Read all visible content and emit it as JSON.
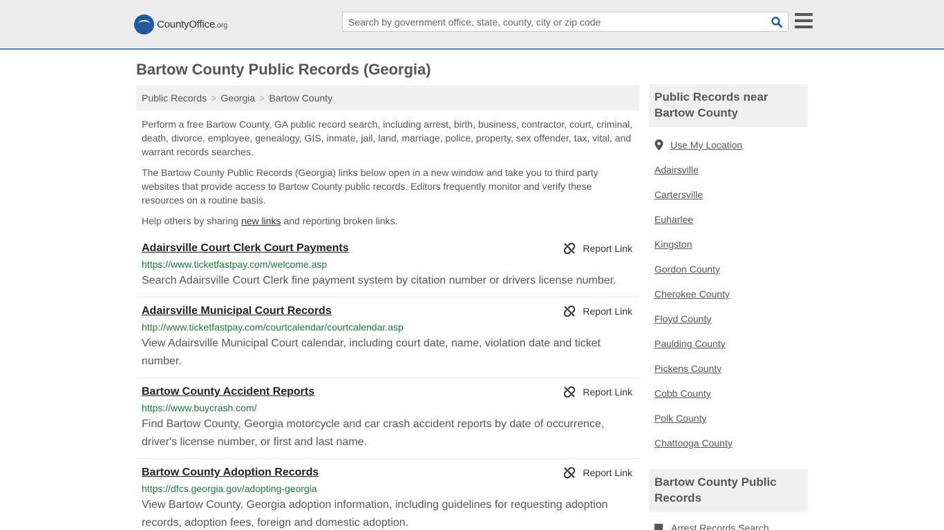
{
  "header": {
    "logo_main": "CountyOffice",
    "logo_org": ".org",
    "search_placeholder": "Search by government office, state, county, city or zip code"
  },
  "page": {
    "title": "Bartow County Public Records (Georgia)"
  },
  "breadcrumb": [
    "Public Records",
    "Georgia",
    "Bartow County"
  ],
  "intro": {
    "p1": "Perform a free Bartow County, GA public record search, including arrest, birth, business, contractor, court, criminal, death, divorce, employee, genealogy, GIS, inmate, jail, land, marriage, police, property, sex offender, tax, vital, and warrant records searches.",
    "p2": "The Bartow County Public Records (Georgia) links below open in a new window and take you to third party websites that provide access to Bartow County public records. Editors frequently monitor and verify these resources on a routine basis.",
    "p3_before": "Help others by sharing ",
    "p3_link": "new links",
    "p3_after": " and reporting broken links."
  },
  "report_label": "Report Link",
  "records": [
    {
      "title": "Adairsville Court Clerk Court Payments",
      "url": "https://www.ticketfastpay.com/welcome.asp",
      "desc": "Search Adairsville Court Clerk fine payment system by citation number or drivers license number."
    },
    {
      "title": "Adairsville Municipal Court Records",
      "url": "http://www.ticketfastpay.com/courtcalendar/courtcalendar.asp",
      "desc": "View Adairsville Municipal Court calendar, including court date, name, violation date and ticket number."
    },
    {
      "title": "Bartow County Accident Reports",
      "url": "https://www.buycrash.com/",
      "desc": "Find Bartow County, Georgia motorcycle and car crash accident reports by date of occurrence, driver's license number, or first and last name."
    },
    {
      "title": "Bartow County Adoption Records",
      "url": "https://dfcs.georgia.gov/adopting-georgia",
      "desc": "View Bartow County, Georgia adoption information, including guidelines for requesting adoption records, adoption fees, foreign and domestic adoption."
    }
  ],
  "sidebar": {
    "near_heading": "Public Records near Bartow County",
    "use_location": "Use My Location",
    "near_links": [
      "Adairsville",
      "Cartersville",
      "Euharlee",
      "Kingston",
      "Gordon County",
      "Cherokee County",
      "Floyd County",
      "Paulding County",
      "Pickens County",
      "Cobb County",
      "Polk County",
      "Chattooga County"
    ],
    "county_heading": "Bartow County Public Records",
    "county_links": [
      "Arrest Records Search"
    ]
  },
  "colors": {
    "accent_border": "#4a86c5",
    "url_green": "#1a7a3a",
    "logo_blue": "#1e5a9c"
  }
}
